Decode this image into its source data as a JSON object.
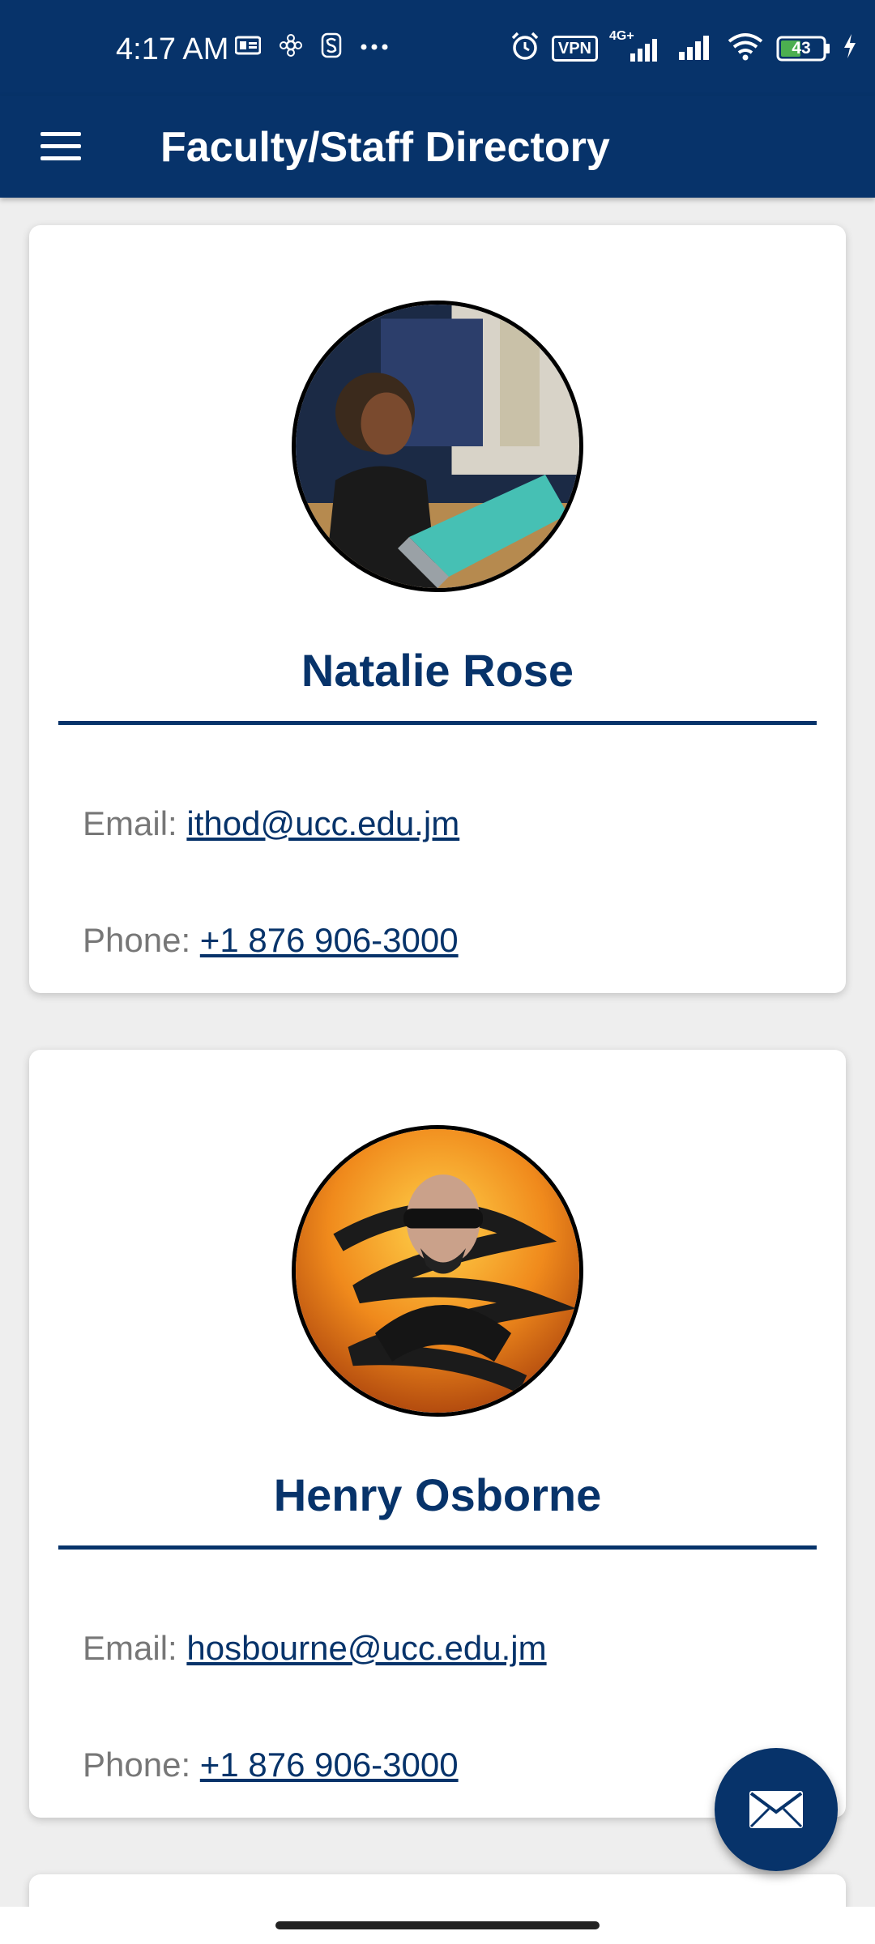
{
  "status_bar": {
    "time": "4:17 AM",
    "vpn_label": "VPN",
    "network_label": "4G+",
    "battery_level": "43",
    "icons": [
      "sim-card-icon",
      "settings-flower-icon",
      "s-app-icon",
      "more-dots-icon",
      "alarm-icon",
      "vpn-icon",
      "signal-icon",
      "signal-icon",
      "wifi-icon",
      "battery-icon",
      "charging-icon"
    ]
  },
  "app_bar": {
    "title": "Faculty/Staff Directory",
    "menu_icon": "hamburger-menu-icon"
  },
  "contacts": [
    {
      "name": "Natalie Rose",
      "email_label": "Email:",
      "email": "ithod@ucc.edu.jm",
      "phone_label": "Phone:",
      "phone": "+1 876 906-3000"
    },
    {
      "name": "Henry Osborne",
      "email_label": "Email:",
      "email": "hosbourne@ucc.edu.jm",
      "phone_label": "Phone:",
      "phone": "+1 876 906-3000"
    }
  ],
  "fab": {
    "icon": "envelope-icon"
  },
  "colors": {
    "primary": "#07336a",
    "background": "#eeeeee",
    "label": "#777777"
  }
}
